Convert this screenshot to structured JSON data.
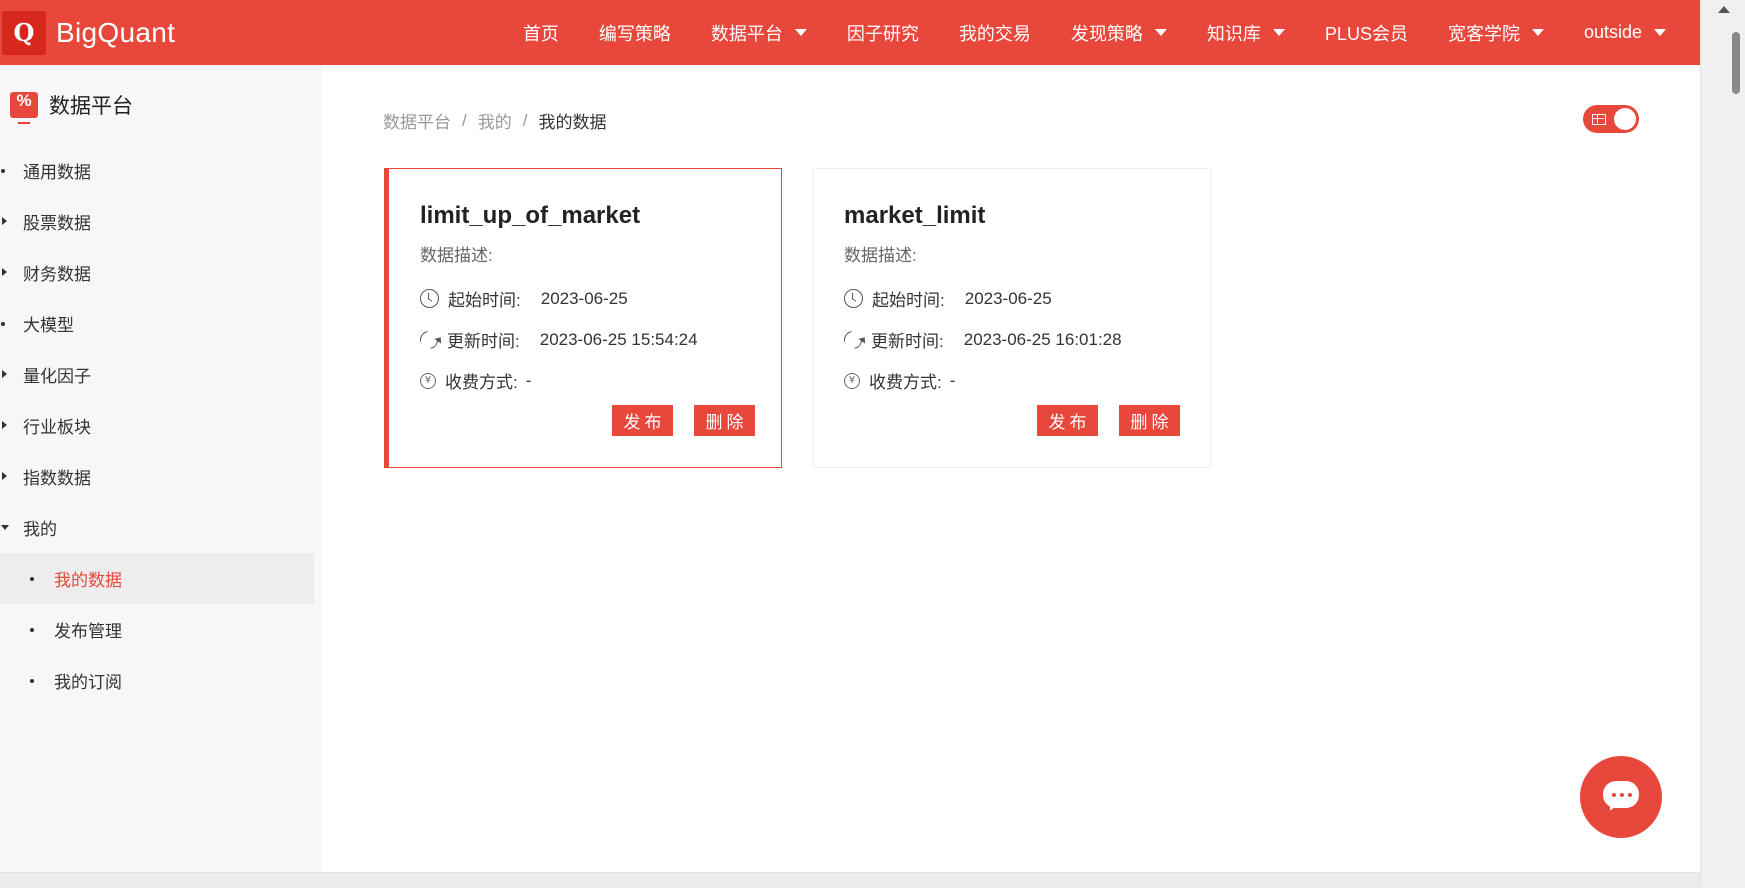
{
  "brand": {
    "logo_letter": "Q",
    "name": "BigQuant",
    "color": "#e8473c"
  },
  "nav": {
    "items": [
      {
        "label": "首页",
        "has_dropdown": false
      },
      {
        "label": "编写策略",
        "has_dropdown": false
      },
      {
        "label": "数据平台",
        "has_dropdown": true
      },
      {
        "label": "因子研究",
        "has_dropdown": false
      },
      {
        "label": "我的交易",
        "has_dropdown": false
      },
      {
        "label": "发现策略",
        "has_dropdown": true
      },
      {
        "label": "知识库",
        "has_dropdown": true
      },
      {
        "label": "PLUS会员",
        "has_dropdown": false
      },
      {
        "label": "宽客学院",
        "has_dropdown": true
      },
      {
        "label": "outside",
        "has_dropdown": true
      }
    ]
  },
  "sidebar": {
    "title": "数据平台",
    "icon": "data-platform-icon",
    "items": [
      {
        "label": "通用数据",
        "marker": "bullet"
      },
      {
        "label": "股票数据",
        "marker": "expand"
      },
      {
        "label": "财务数据",
        "marker": "expand"
      },
      {
        "label": "大模型",
        "marker": "bullet"
      },
      {
        "label": "量化因子",
        "marker": "expand"
      },
      {
        "label": "行业板块",
        "marker": "expand"
      },
      {
        "label": "指数数据",
        "marker": "expand"
      },
      {
        "label": "我的",
        "marker": "collapse"
      }
    ],
    "sub_items": [
      {
        "label": "我的数据",
        "active": true
      },
      {
        "label": "发布管理",
        "active": false
      },
      {
        "label": "我的订阅",
        "active": false
      }
    ]
  },
  "breadcrumb": {
    "items": [
      "数据平台",
      "我的",
      "我的数据"
    ],
    "separator": "/"
  },
  "view_toggle": {
    "icon": "grid-view-icon",
    "state": "on"
  },
  "cards": [
    {
      "title": "limit_up_of_market",
      "desc_label": "数据描述:",
      "start_label": "起始时间:",
      "start_value": "2023-06-25",
      "update_label": "更新时间:",
      "update_value": "2023-06-25 15:54:24",
      "fee_label": "收费方式:",
      "fee_value": "-",
      "publish_label": "发布",
      "delete_label": "删除",
      "selected": true
    },
    {
      "title": "market_limit",
      "desc_label": "数据描述:",
      "start_label": "起始时间:",
      "start_value": "2023-06-25",
      "update_label": "更新时间:",
      "update_value": "2023-06-25 16:01:28",
      "fee_label": "收费方式:",
      "fee_value": "-",
      "publish_label": "发布",
      "delete_label": "删除",
      "selected": false
    }
  ],
  "chat_button": {
    "icon": "chat-bubble-icon"
  }
}
